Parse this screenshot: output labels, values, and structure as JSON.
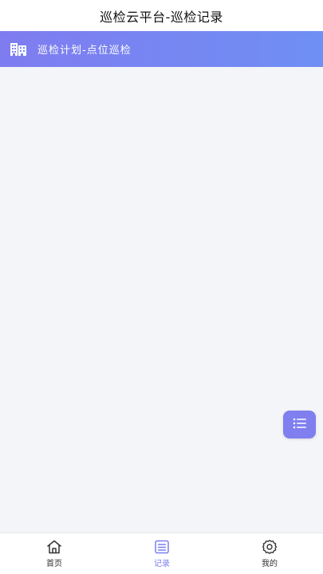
{
  "header": {
    "title": "巡检云平台-巡检记录"
  },
  "banner": {
    "icon": "building-icon",
    "text": "巡检计划-点位巡检"
  },
  "fab": {
    "icon": "list-icon"
  },
  "tabbar": {
    "items": [
      {
        "label": "首页",
        "icon": "home-icon",
        "active": false
      },
      {
        "label": "记录",
        "icon": "record-list-icon",
        "active": true
      },
      {
        "label": "我的",
        "icon": "gear-icon",
        "active": false
      }
    ]
  },
  "colors": {
    "accent": "#7b7ff0",
    "banner_start": "#7f7cf0",
    "banner_end": "#6f8ff4",
    "background": "#f4f5f8"
  }
}
